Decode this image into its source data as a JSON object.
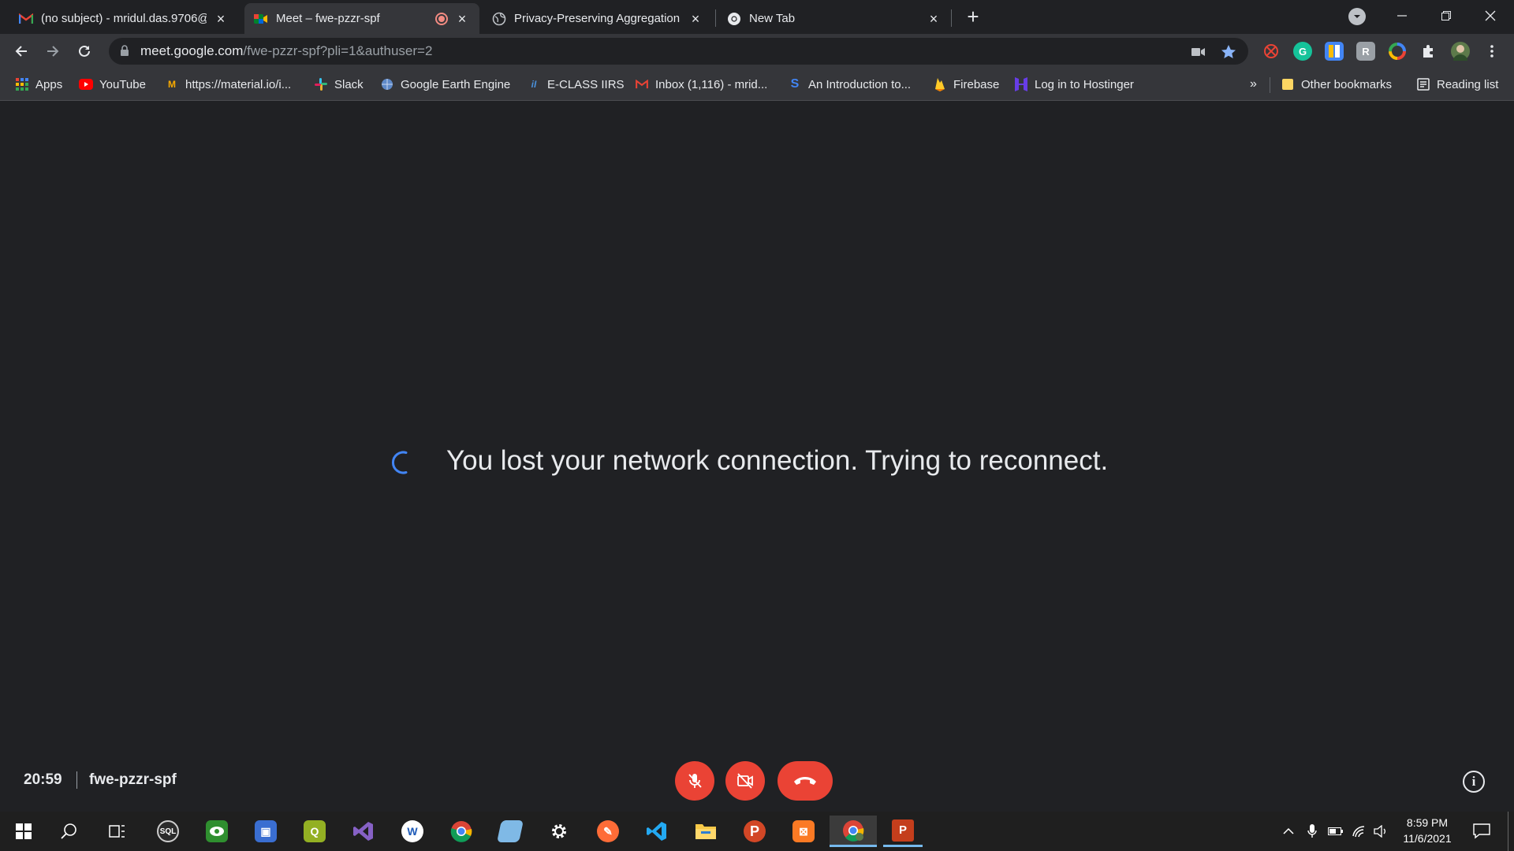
{
  "tabs": [
    {
      "title": "(no subject) - mridul.das.9706@g",
      "favicon": "gmail-icon",
      "active": false
    },
    {
      "title": "Meet – fwe-pzzr-spf",
      "favicon": "meet-icon",
      "active": true,
      "recording": true
    },
    {
      "title": "Privacy-Preserving Aggregation f",
      "favicon": "globe-icon",
      "active": false
    },
    {
      "title": "New Tab",
      "favicon": "chrome-icon",
      "active": false
    }
  ],
  "omnibox": {
    "host": "meet.google.com",
    "path": "/fwe-pzzr-spf?pli=1&authuser=2"
  },
  "bookmarks": [
    {
      "label": "Apps",
      "icon": "apps-grid-icon"
    },
    {
      "label": "YouTube",
      "icon": "youtube-icon"
    },
    {
      "label": "https://material.io/i...",
      "icon": "material-icon"
    },
    {
      "label": "Slack",
      "icon": "slack-icon"
    },
    {
      "label": "Google Earth Engine",
      "icon": "earth-engine-icon"
    },
    {
      "label": "E-CLASS IIRS",
      "icon": "iirs-icon"
    },
    {
      "label": "Inbox (1,116) - mrid...",
      "icon": "gmail-icon"
    },
    {
      "label": "An Introduction to...",
      "icon": "s-icon"
    },
    {
      "label": "Firebase",
      "icon": "firebase-icon"
    },
    {
      "label": "Log in to Hostinger",
      "icon": "hostinger-icon"
    }
  ],
  "bookmarks_more": "»",
  "other_bookmarks": "Other bookmarks",
  "reading_list": "Reading list",
  "meet": {
    "message": "You lost your network connection. Trying to reconnect.",
    "clock": "20:59",
    "meeting_code": "fwe-pzzr-spf"
  },
  "taskbar": {
    "time": "8:59 PM",
    "date": "11/6/2021"
  },
  "colors": {
    "background": "#202124",
    "chrome_bar": "#35363a",
    "danger": "#ea4335",
    "spinner": "#4285f4",
    "text": "#e8eaed"
  }
}
